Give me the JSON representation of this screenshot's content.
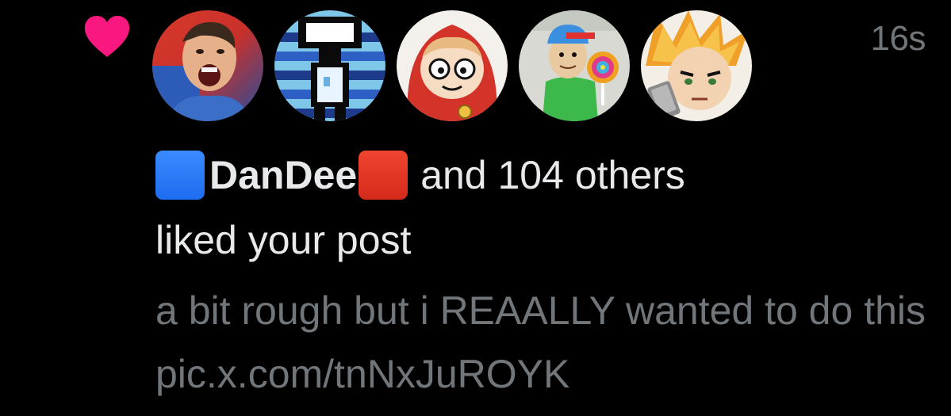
{
  "notification": {
    "type_icon": "heart-icon",
    "timestamp": "16s",
    "avatars": [
      {
        "name": "avatar-screaming-man"
      },
      {
        "name": "avatar-pixel-character"
      },
      {
        "name": "avatar-cartoon-girl"
      },
      {
        "name": "avatar-baldi-lollipop"
      },
      {
        "name": "avatar-anime-character"
      }
    ],
    "actor_name": "DanDee",
    "others_text": "and 104 others",
    "action_text": "liked your post",
    "post_text": "a bit rough but i REAALLY wanted to do this pic.x.com/tnNxJuROYK"
  },
  "colors": {
    "background": "#000000",
    "heart": "#f91880",
    "primary_text": "#e7e9ea",
    "secondary_text": "#71767b",
    "blue_square": "#2a7cf7",
    "red_square": "#e0361f"
  }
}
